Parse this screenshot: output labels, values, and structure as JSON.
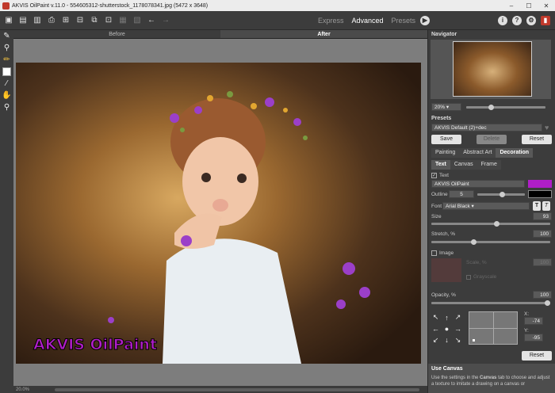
{
  "window": {
    "title": "AKVIS OilPaint v.11.0 - 554605312-shutterstock_1178078341.jpg (5472 x 3648)",
    "minimize": "–",
    "maximize": "☐",
    "close": "✕"
  },
  "toolbar": {
    "modes": [
      "Express",
      "Advanced",
      "Presets"
    ],
    "active_mode": "Advanced"
  },
  "canvas": {
    "tabs": [
      "Before",
      "After"
    ],
    "active_tab": "After",
    "watermark_text": "AKVIS OilPaint",
    "zoom_status": "20.0%"
  },
  "navigator": {
    "header": "Navigator",
    "zoom_value": "20%"
  },
  "presets": {
    "header": "Presets",
    "selected": "AKVIS Default (2)+dec",
    "save": "Save",
    "delete": "Delete",
    "reset": "Reset"
  },
  "settings_tabs": [
    "Painting",
    "Abstract Art",
    "Decoration"
  ],
  "active_settings_tab": "Decoration",
  "decoration_tabs": [
    "Text",
    "Canvas",
    "Frame"
  ],
  "active_decoration_tab": "Text",
  "text_settings": {
    "text_checkbox_label": "Text",
    "text_value": "AKVIS OilPaint",
    "text_color": "#b01ec8",
    "outline_label": "Outline",
    "outline_value": "5",
    "outline_color": "#000000",
    "font_label": "Font",
    "font_value": "Arial Black",
    "size_label": "Size",
    "size_value": "93",
    "size_fraction": 0.55,
    "stretch_label": "Stretch, %",
    "stretch_value": "100",
    "stretch_fraction": 0.35,
    "image_label": "Image",
    "scale_label": "Scale, %",
    "scale_value": "100",
    "grayscale_label": "Grayscale",
    "opacity_label": "Opacity, %",
    "opacity_value": "100",
    "opacity_fraction": 1.0,
    "x_label": "X:",
    "x_value": "-74",
    "y_label": "Y:",
    "y_value": "-95",
    "reset": "Reset"
  },
  "help": {
    "title": "Use Canvas",
    "body_prefix": "Use the settings in the ",
    "body_bold": "Canvas",
    "body_suffix": " tab to choose and adjust a texture to imitate a drawing on a canvas or"
  },
  "colors": {
    "accent_magenta": "#b01ec8",
    "panel_bg": "#3c3c3c"
  }
}
